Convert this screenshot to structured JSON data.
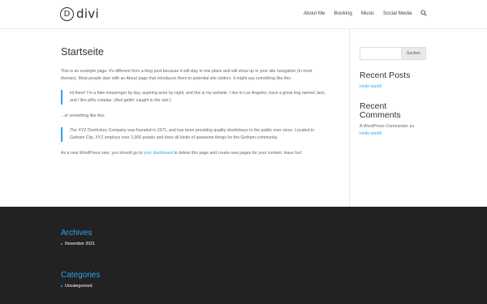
{
  "header": {
    "logo_mark": "D",
    "logo_text": "divi",
    "nav": [
      "About Me",
      "Booking",
      "Music",
      "Social Media"
    ]
  },
  "main": {
    "title": "Startseite",
    "intro": "This is an example page. It's different from a blog post because it will stay in one place and will show up in your site navigation (in most themes). Most people start with an About page that introduces them to potential site visitors. It might say something like this:",
    "quote1": "Hi there! I'm a bike messenger by day, aspiring actor by night, and this is my website. I live in Los Angeles, have a great dog named Jack, and I like piña coladas. (And gettin' caught in the rain.)",
    "or_text": "...or something like this:",
    "quote2": "The XYZ Doohickey Company was founded in 1971, and has been providing quality doohickeys to the public ever since. Located in Gotham City, XYZ employs over 2,000 people and does all kinds of awesome things for the Gotham community.",
    "outro_before": "As a new WordPress user, you should go to ",
    "outro_link": "your dashboard",
    "outro_after": " to delete this page and create new pages for your content. Have fun!"
  },
  "sidebar": {
    "search_button": "Suchen",
    "recent_posts_title": "Recent Posts",
    "recent_posts": [
      "Hello world!"
    ],
    "recent_comments_title": "Recent Comments",
    "comment_author": "A WordPress Commenter",
    "comment_on": "zu",
    "comment_post": "Hello world!"
  },
  "footer": {
    "archives_title": "Archives",
    "archives_item": "November 2021",
    "categories_title": "Categories",
    "categories_item": "Uncategorized"
  },
  "colors": {
    "accent": "#2ea3f2",
    "footer_bg": "#222222"
  }
}
